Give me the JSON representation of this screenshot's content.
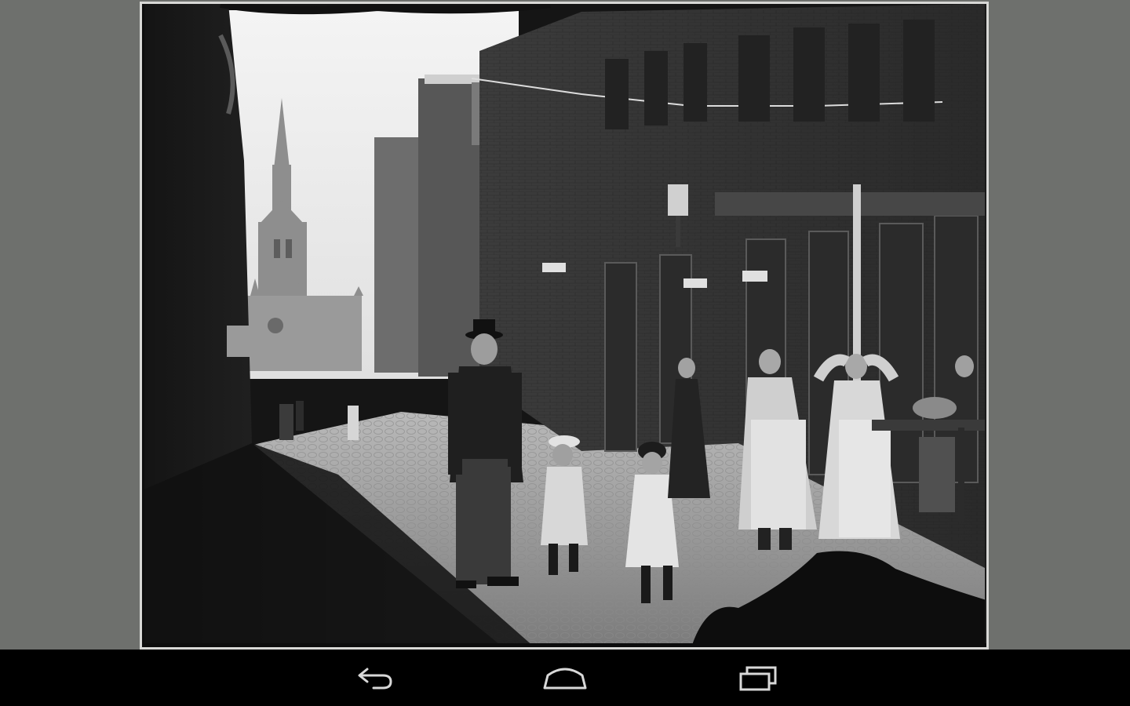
{
  "app": {
    "background_color": "#6e706d"
  },
  "photo": {
    "subject": "street-photo",
    "style": "black-and-white"
  },
  "navbar": {
    "background_color": "#000000",
    "icon_color": "#d8d8d8",
    "buttons": [
      {
        "icon": "back-icon"
      },
      {
        "icon": "home-icon"
      },
      {
        "icon": "recent-apps-icon"
      }
    ]
  }
}
